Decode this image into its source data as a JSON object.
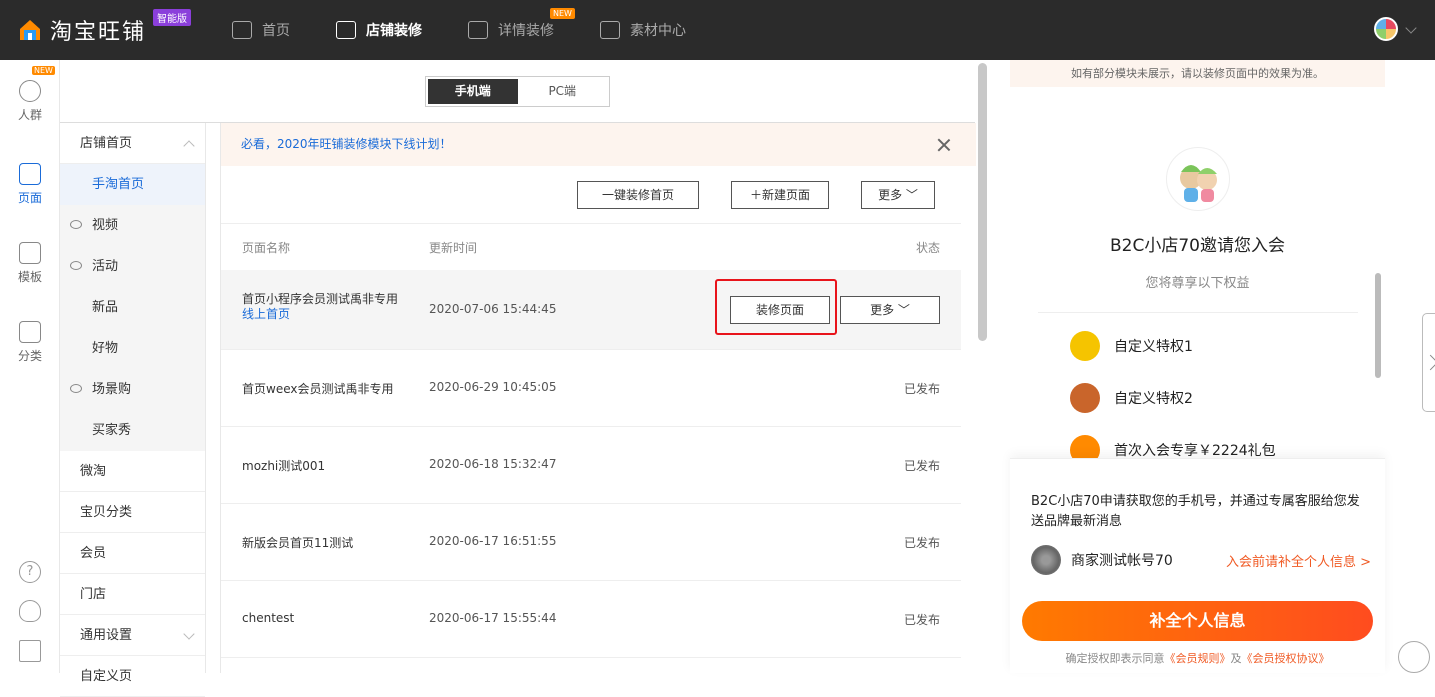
{
  "topbar": {
    "brand": "淘宝旺铺",
    "edition_badge": "智能版",
    "nav": [
      {
        "label": "首页",
        "icon": "home-icon"
      },
      {
        "label": "店铺装修",
        "icon": "store-icon"
      },
      {
        "label": "详情装修",
        "icon": "detail-icon",
        "badge": "NEW"
      },
      {
        "label": "素材中心",
        "icon": "folder-icon"
      }
    ],
    "active_nav": "店铺装修",
    "colors": {
      "bg": "#2b2b2b",
      "accent": "#1a6bd8",
      "badge": "#8b3fdb",
      "new_badge": "#ff8a00"
    }
  },
  "rail": {
    "items": [
      {
        "label": "人群",
        "icon": "people-icon",
        "badge": "NEW"
      },
      {
        "label": "页面",
        "icon": "page-icon",
        "active": true
      },
      {
        "label": "模板",
        "icon": "template-icon"
      },
      {
        "label": "分类",
        "icon": "category-icon"
      }
    ],
    "bottom_icons": [
      "help-icon",
      "headset-icon",
      "edit-icon"
    ],
    "help_glyph": "?"
  },
  "subnav": {
    "items": [
      {
        "label": "店铺首页",
        "expandable": true,
        "expanded": true
      },
      {
        "label": "手淘首页",
        "sub": true,
        "active": true
      },
      {
        "label": "视频",
        "sub": true,
        "hidden_icon": true
      },
      {
        "label": "活动",
        "sub": true,
        "hidden_icon": true
      },
      {
        "label": "新品",
        "sub": true
      },
      {
        "label": "好物",
        "sub": true
      },
      {
        "label": "场景购",
        "sub": true,
        "hidden_icon": true
      },
      {
        "label": "买家秀",
        "sub": true
      },
      {
        "label": "微淘"
      },
      {
        "label": "宝贝分类"
      },
      {
        "label": "会员"
      },
      {
        "label": "门店"
      },
      {
        "label": "通用设置",
        "expandable": true
      },
      {
        "label": "自定义页"
      }
    ]
  },
  "device_toggle": {
    "options": [
      "手机端",
      "PC端"
    ],
    "selected": "手机端"
  },
  "notice": {
    "text": "必看，2020年旺铺装修模块下线计划！"
  },
  "toolbar": {
    "one_click": "一键装修首页",
    "new_page": "新建页面",
    "more": "更多"
  },
  "table": {
    "headers": {
      "name": "页面名称",
      "time": "更新时间",
      "status": "状态"
    },
    "rows": [
      {
        "name": "首页小程序会员测试禹非专用",
        "tag": "线上首页",
        "time": "2020-07-06 15:44:45",
        "decorate": "装修页面",
        "more": "更多"
      },
      {
        "name": "首页weex会员测试禹非专用",
        "time": "2020-06-29 10:45:05",
        "status": "已发布"
      },
      {
        "name": "mozhi测试001",
        "time": "2020-06-18 15:32:47",
        "status": "已发布"
      },
      {
        "name": "新版会员首页11测试",
        "time": "2020-06-17 16:51:55",
        "status": "已发布"
      },
      {
        "name": "chentest",
        "time": "2020-06-17 15:55:44",
        "status": "已发布"
      }
    ]
  },
  "preview": {
    "tip": "如有部分模块未展示，请以装修页面中的效果为准。",
    "title": "B2C小店70邀请您入会",
    "subtitle": "您将尊享以下权益",
    "perks": [
      {
        "label": "自定义特权1",
        "color": "#f5c400"
      },
      {
        "label": "自定义特权2",
        "color": "#c9652b"
      },
      {
        "label": "首次入会专享￥2224礼包",
        "color": "#ff8a00"
      }
    ],
    "phone_request": "B2C小店70申请获取您的手机号，并通过专属客服给您发送品牌最新消息",
    "merchant": "商家测试帐号70",
    "merchant_link": "入会前请补全个人信息 >",
    "cta": "补全个人信息",
    "agree_prefix": "确定授权即表示同意",
    "rule_link": "《会员规则》",
    "and": "及",
    "auth_link": "《会员授权协议》"
  }
}
